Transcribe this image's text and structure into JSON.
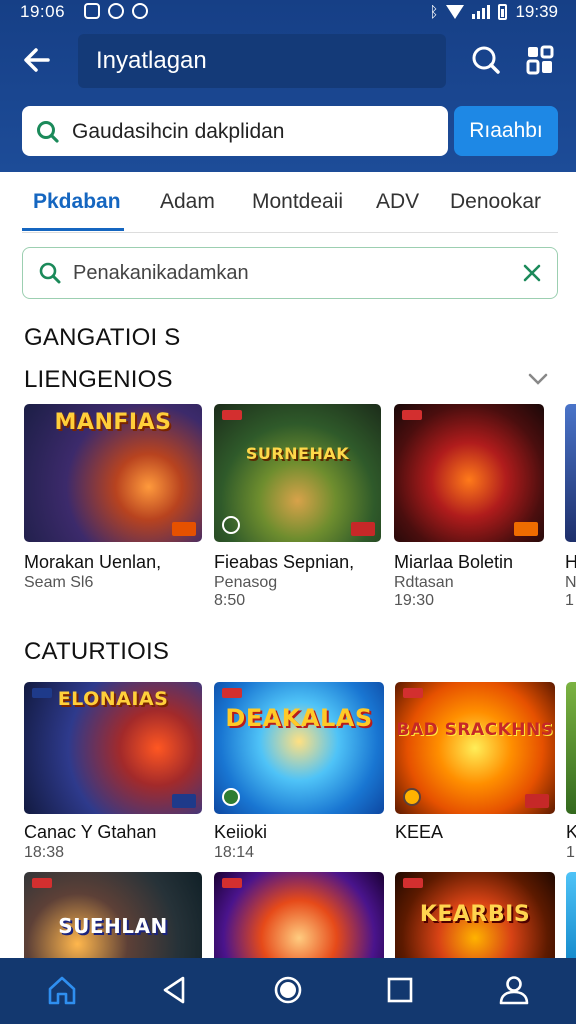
{
  "status_bar": {
    "time_left": "19:06",
    "time_right": "19:39"
  },
  "header": {
    "title": "Inyatlagan",
    "search_label": "Gaudasihcin dakplidan",
    "search_button": "Rıaahbı"
  },
  "tabs": [
    {
      "label": "Pkdaban",
      "active": true
    },
    {
      "label": "Adam",
      "active": false
    },
    {
      "label": "Montdeaii",
      "active": false
    },
    {
      "label": "ADV",
      "active": false
    },
    {
      "label": "Denookar",
      "active": false
    }
  ],
  "filter": {
    "text": "Penakanikadamkan"
  },
  "sections": [
    {
      "title": "GANGATIOI S",
      "subtitle": "LIENGENIOS",
      "cards": [
        {
          "art": "MANFIAS",
          "name": "Morakan Uenlan,",
          "line1": "Seam Sl6",
          "line2": ""
        },
        {
          "art": "SURNEHAK",
          "name": "Fieabas Sepnian,",
          "line1": "Penasog",
          "line2": "8:50"
        },
        {
          "art": "",
          "name": "Miarlaa Boletin",
          "line1": "Rdtasan",
          "line2": "19:30"
        },
        {
          "art": "",
          "name": "H",
          "line1": "N",
          "line2": "1"
        }
      ]
    },
    {
      "title": "CATURTIOIS",
      "cards": [
        {
          "art": "ELONAIAS",
          "name": "Canac Y Gtahan",
          "line1": "18:38"
        },
        {
          "art": "DEAKALAS",
          "name": "Keiioki",
          "line1": "18:14"
        },
        {
          "art": "BAD SRACKHNS",
          "name": "KEEA",
          "line1": ""
        },
        {
          "art": "",
          "name": "K",
          "line1": "1"
        }
      ]
    },
    {
      "cards": [
        {
          "art": "SUEHLAN"
        },
        {
          "art": ""
        },
        {
          "art": "KEARBIS"
        },
        {
          "art": ""
        }
      ]
    }
  ],
  "colors": {
    "header_bg": "#1d4c98",
    "accent": "#1566c0",
    "button": "#1e88e5",
    "nav_bg": "#13386f"
  },
  "bottom_nav": [
    "home-icon",
    "back-icon",
    "circle-home-icon",
    "square-recents-icon",
    "profile-icon"
  ]
}
